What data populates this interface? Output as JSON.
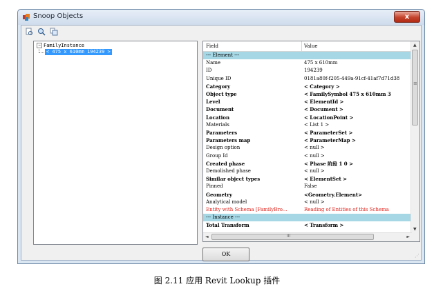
{
  "window": {
    "title": "Snoop Objects",
    "close_label": "x"
  },
  "toolbar": {
    "icons": [
      "snoop-icon",
      "search-icon",
      "copy-icon"
    ]
  },
  "tree": {
    "root_expander": "−",
    "root_label": "FamilyInstance",
    "child_label": "< 475 x 610mm  194239 >"
  },
  "grid": {
    "header": {
      "field": "Field",
      "value": "Value"
    },
    "rows": [
      {
        "field": "--- Element ---",
        "value": "",
        "kind": "section"
      },
      {
        "field": "Name",
        "value": "475 x 610mm",
        "kind": "normal"
      },
      {
        "field": "ID",
        "value": "194239",
        "kind": "normal"
      },
      {
        "field": "Unique ID",
        "value": "0181a80f-f205-449a-91cf-41af7d71d38",
        "kind": "normal"
      },
      {
        "field": "Category",
        "value": "< Category >",
        "kind": "bold"
      },
      {
        "field": "Object type",
        "value": "< FamilySymbol  475 x 610mm  3",
        "kind": "bold"
      },
      {
        "field": "Level",
        "value": "< ElementId >",
        "kind": "bold"
      },
      {
        "field": "Document",
        "value": "< Document >",
        "kind": "bold"
      },
      {
        "field": "Location",
        "value": "< LocationPoint >",
        "kind": "bold"
      },
      {
        "field": "Materials",
        "value": "< List 1 >",
        "kind": "normal"
      },
      {
        "field": "Parameters",
        "value": "< ParameterSet >",
        "kind": "bold"
      },
      {
        "field": "Parameters map",
        "value": "< ParameterMap >",
        "kind": "bold"
      },
      {
        "field": "Design option",
        "value": "< null >",
        "kind": "normal"
      },
      {
        "field": "Group Id",
        "value": "< null >",
        "kind": "normal"
      },
      {
        "field": "Created phase",
        "value": "< Phase  阶段 1      0 >",
        "kind": "bold"
      },
      {
        "field": "Demolished phase",
        "value": "< null >",
        "kind": "normal"
      },
      {
        "field": "Similar object types",
        "value": "< ElementSet >",
        "kind": "bold"
      },
      {
        "field": "Pinned",
        "value": "False",
        "kind": "normal"
      },
      {
        "field": "Geometry",
        "value": "<Geometry.Element>",
        "kind": "bold"
      },
      {
        "field": "Analytical model",
        "value": "< null >",
        "kind": "normal"
      },
      {
        "field": "Entity with Schema [FamilyBro...",
        "value": "Reading of Entities of this Schema",
        "kind": "red"
      },
      {
        "field": "--- Instance ---",
        "value": "",
        "kind": "section"
      },
      {
        "field": "Total Transform",
        "value": "< Transform >",
        "kind": "bold"
      }
    ]
  },
  "scrollbar": {
    "up": "▲",
    "down": "▼",
    "left": "◄",
    "right": "►",
    "thumb_grip": "≡",
    "h_grip": "III"
  },
  "buttons": {
    "ok": "OK"
  },
  "caption": "图 2.11 应用 Revit Lookup 插件"
}
